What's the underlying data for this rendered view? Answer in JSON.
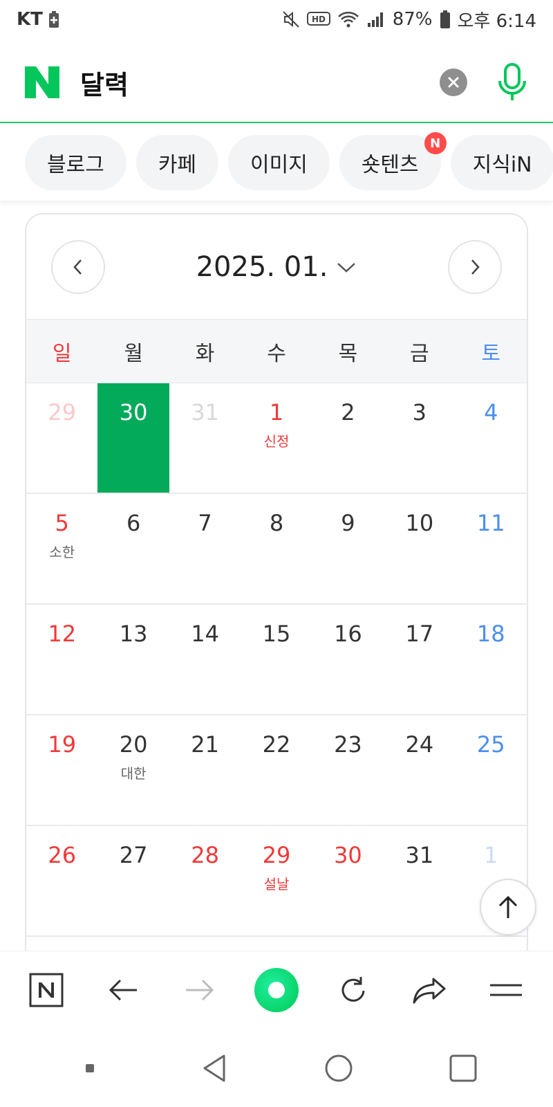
{
  "status_bar": {
    "carrier": "KT",
    "battery_percent": "87%",
    "time": "오후 6:14",
    "hd_label": "HD"
  },
  "search": {
    "query": "달력",
    "logo_letter": "N"
  },
  "tabs": [
    {
      "label": "블로그",
      "badge": ""
    },
    {
      "label": "카페",
      "badge": ""
    },
    {
      "label": "이미지",
      "badge": ""
    },
    {
      "label": "숏텐츠",
      "badge": "N"
    },
    {
      "label": "지식iN",
      "badge": ""
    }
  ],
  "calendar": {
    "month_label": "2025. 01.",
    "weekdays": [
      "일",
      "월",
      "화",
      "수",
      "목",
      "금",
      "토"
    ],
    "weeks": [
      [
        {
          "day": "29",
          "note": "",
          "other": true
        },
        {
          "day": "30",
          "note": "",
          "other": true,
          "selected": true
        },
        {
          "day": "31",
          "note": "",
          "other": true
        },
        {
          "day": "1",
          "note": "신정",
          "holiday": true
        },
        {
          "day": "2",
          "note": ""
        },
        {
          "day": "3",
          "note": ""
        },
        {
          "day": "4",
          "note": ""
        }
      ],
      [
        {
          "day": "5",
          "note": "소한"
        },
        {
          "day": "6",
          "note": ""
        },
        {
          "day": "7",
          "note": ""
        },
        {
          "day": "8",
          "note": ""
        },
        {
          "day": "9",
          "note": ""
        },
        {
          "day": "10",
          "note": ""
        },
        {
          "day": "11",
          "note": ""
        }
      ],
      [
        {
          "day": "12",
          "note": ""
        },
        {
          "day": "13",
          "note": ""
        },
        {
          "day": "14",
          "note": ""
        },
        {
          "day": "15",
          "note": ""
        },
        {
          "day": "16",
          "note": ""
        },
        {
          "day": "17",
          "note": ""
        },
        {
          "day": "18",
          "note": ""
        }
      ],
      [
        {
          "day": "19",
          "note": ""
        },
        {
          "day": "20",
          "note": "대한"
        },
        {
          "day": "21",
          "note": ""
        },
        {
          "day": "22",
          "note": ""
        },
        {
          "day": "23",
          "note": ""
        },
        {
          "day": "24",
          "note": ""
        },
        {
          "day": "25",
          "note": ""
        }
      ],
      [
        {
          "day": "26",
          "note": ""
        },
        {
          "day": "27",
          "note": ""
        },
        {
          "day": "28",
          "note": "",
          "holiday": true
        },
        {
          "day": "29",
          "note": "설날",
          "holiday": true
        },
        {
          "day": "30",
          "note": "",
          "holiday": true
        },
        {
          "day": "31",
          "note": ""
        },
        {
          "day": "1",
          "note": "",
          "other": true
        }
      ]
    ]
  },
  "colors": {
    "naver_green": "#03c75a",
    "selected_day": "#03aa5a",
    "sunday_red": "#f23838",
    "saturday_blue": "#4b8ef0"
  },
  "icons": {
    "toolbar": [
      "naver-home-icon",
      "back-arrow-icon",
      "forward-arrow-icon",
      "green-dot-icon",
      "refresh-icon",
      "share-icon",
      "menu-icon"
    ],
    "system_nav": [
      "recent-dot-icon",
      "back-triangle-icon",
      "home-circle-icon",
      "overview-square-icon"
    ]
  }
}
